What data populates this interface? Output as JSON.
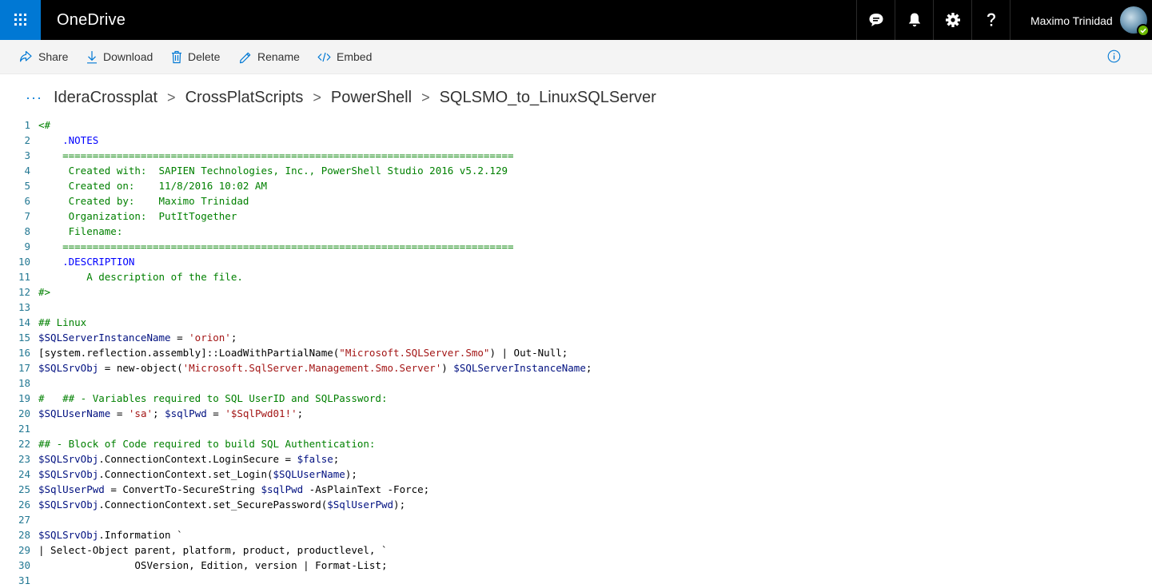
{
  "header": {
    "app_name": "OneDrive",
    "user_name": "Maximo Trinidad",
    "icons": [
      "waffle-icon",
      "feedback-icon",
      "bell-icon",
      "gear-icon",
      "help-icon"
    ]
  },
  "toolbar": {
    "share": "Share",
    "download": "Download",
    "delete": "Delete",
    "rename": "Rename",
    "embed": "Embed"
  },
  "breadcrumb": {
    "ellipsis": "···",
    "items": [
      "IderaCrossplat",
      "CrossPlatScripts",
      "PowerShell",
      "SQLSMO_to_LinuxSQLServer"
    ],
    "separator": ">"
  },
  "code": {
    "lines": [
      [
        {
          "t": "<#",
          "c": "c"
        }
      ],
      [
        {
          "t": "    .NOTES",
          "c": "k"
        }
      ],
      [
        {
          "t": "    ===========================================================================",
          "c": "c"
        }
      ],
      [
        {
          "t": "     Created with:  SAPIEN Technologies, Inc., PowerShell Studio 2016 v5.2.129",
          "c": "c"
        }
      ],
      [
        {
          "t": "     Created on:    11/8/2016 10:02 AM",
          "c": "c"
        }
      ],
      [
        {
          "t": "     Created by:    Maximo Trinidad",
          "c": "c"
        }
      ],
      [
        {
          "t": "     Organization:  PutItTogether",
          "c": "c"
        }
      ],
      [
        {
          "t": "     Filename:",
          "c": "c"
        }
      ],
      [
        {
          "t": "    ===========================================================================",
          "c": "c"
        }
      ],
      [
        {
          "t": "    .DESCRIPTION",
          "c": "k"
        }
      ],
      [
        {
          "t": "        A description of the file.",
          "c": "c"
        }
      ],
      [
        {
          "t": "#>",
          "c": "c"
        }
      ],
      [],
      [
        {
          "t": "## Linux",
          "c": "c"
        }
      ],
      [
        {
          "t": "$SQLServerInstanceName",
          "c": "v"
        },
        {
          "t": " = ",
          "c": ""
        },
        {
          "t": "'orion'",
          "c": "s"
        },
        {
          "t": ";",
          "c": ""
        }
      ],
      [
        {
          "t": "[system.reflection.assembly]::LoadWithPartialName(",
          "c": ""
        },
        {
          "t": "\"Microsoft.SQLServer.Smo\"",
          "c": "s"
        },
        {
          "t": ") | Out-Null;",
          "c": ""
        }
      ],
      [
        {
          "t": "$SQLSrvObj",
          "c": "v"
        },
        {
          "t": " = new-object(",
          "c": ""
        },
        {
          "t": "'Microsoft.SqlServer.Management.Smo.Server'",
          "c": "s"
        },
        {
          "t": ") ",
          "c": ""
        },
        {
          "t": "$SQLServerInstanceName",
          "c": "v"
        },
        {
          "t": ";",
          "c": ""
        }
      ],
      [],
      [
        {
          "t": "#   ## - Variables required to SQL UserID and SQLPassword:",
          "c": "c"
        }
      ],
      [
        {
          "t": "$SQLUserName",
          "c": "v"
        },
        {
          "t": " = ",
          "c": ""
        },
        {
          "t": "'sa'",
          "c": "s"
        },
        {
          "t": "; ",
          "c": ""
        },
        {
          "t": "$sqlPwd",
          "c": "v"
        },
        {
          "t": " = ",
          "c": ""
        },
        {
          "t": "'$SqlPwd01!'",
          "c": "s"
        },
        {
          "t": ";",
          "c": ""
        }
      ],
      [],
      [
        {
          "t": "## - Block of Code required to build SQL Authentication:",
          "c": "c"
        }
      ],
      [
        {
          "t": "$SQLSrvObj",
          "c": "v"
        },
        {
          "t": ".ConnectionContext.LoginSecure = ",
          "c": ""
        },
        {
          "t": "$false",
          "c": "v"
        },
        {
          "t": ";",
          "c": ""
        }
      ],
      [
        {
          "t": "$SQLSrvObj",
          "c": "v"
        },
        {
          "t": ".ConnectionContext.set_Login(",
          "c": ""
        },
        {
          "t": "$SQLUserName",
          "c": "v"
        },
        {
          "t": ");",
          "c": ""
        }
      ],
      [
        {
          "t": "$SqlUserPwd",
          "c": "v"
        },
        {
          "t": " = ConvertTo-SecureString ",
          "c": ""
        },
        {
          "t": "$sqlPwd",
          "c": "v"
        },
        {
          "t": " -AsPlainText -Force;",
          "c": ""
        }
      ],
      [
        {
          "t": "$SQLSrvObj",
          "c": "v"
        },
        {
          "t": ".ConnectionContext.set_SecurePassword(",
          "c": ""
        },
        {
          "t": "$SqlUserPwd",
          "c": "v"
        },
        {
          "t": ");",
          "c": ""
        }
      ],
      [],
      [
        {
          "t": "$SQLSrvObj",
          "c": "v"
        },
        {
          "t": ".Information `",
          "c": ""
        }
      ],
      [
        {
          "t": "| Select-Object parent, platform, product, productlevel, `",
          "c": ""
        }
      ],
      [
        {
          "t": "                OSVersion, Edition, version | Format-List;",
          "c": ""
        }
      ],
      []
    ]
  }
}
